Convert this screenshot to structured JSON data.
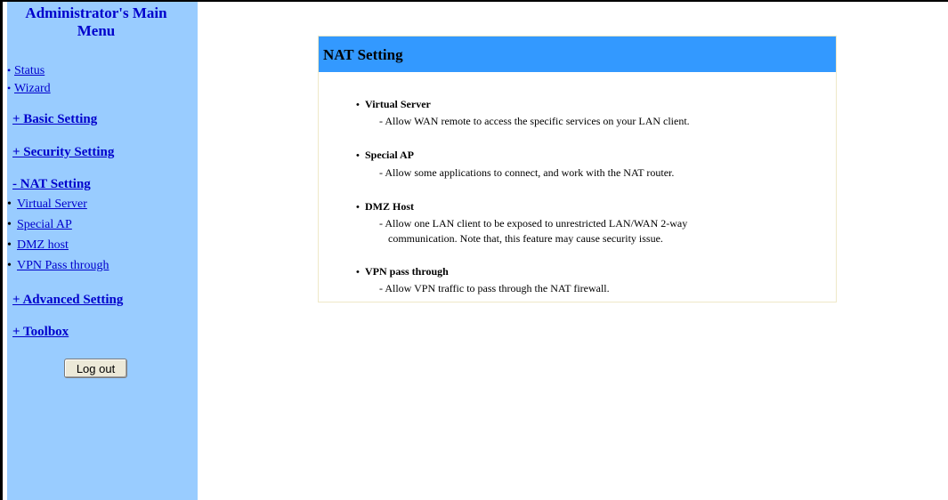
{
  "sidebar": {
    "title": "Administrator's Main Menu",
    "top_links": [
      {
        "label": "Status"
      },
      {
        "label": "Wizard"
      }
    ],
    "sections": {
      "basic": "+ Basic Setting",
      "security": "+ Security Setting",
      "nat": "- NAT Setting",
      "advanced": "+ Advanced Setting",
      "toolbox": "+ Toolbox"
    },
    "nat_items": [
      {
        "label": "Virtual Server"
      },
      {
        "label": "Special AP"
      },
      {
        "label": "DMZ host"
      },
      {
        "label": "VPN Pass through"
      }
    ],
    "logout_label": "Log out"
  },
  "panel": {
    "title": "NAT Setting",
    "features": [
      {
        "title": "Virtual Server",
        "desc": [
          "- Allow WAN remote to access the specific services on your LAN client."
        ]
      },
      {
        "title": "Special AP",
        "desc": [
          "- Allow some applications to connect, and work with the NAT router."
        ]
      },
      {
        "title": "DMZ Host",
        "desc": [
          "- Allow one LAN client to be exposed to unrestricted LAN/WAN 2-way",
          "communication. Note that, this feature may cause security issue."
        ]
      },
      {
        "title": "VPN pass through",
        "desc": [
          "- Allow VPN traffic to pass through the NAT firewall."
        ]
      }
    ]
  },
  "colors": {
    "sidebar_bg": "#99ccff",
    "link": "#0000cc",
    "panel_header": "#3399ff"
  }
}
